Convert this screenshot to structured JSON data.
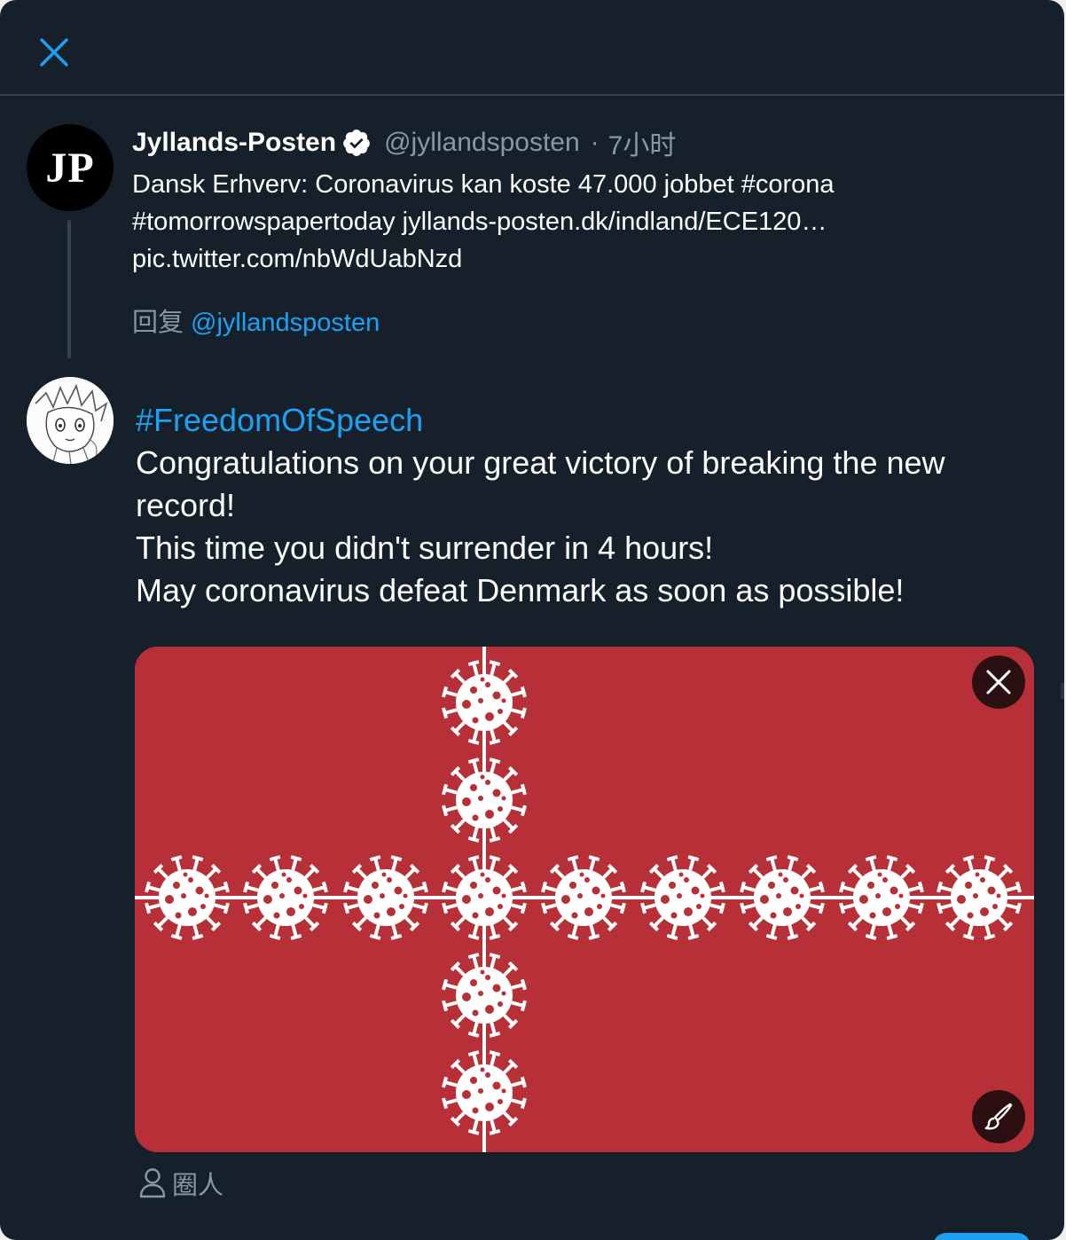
{
  "modal": {
    "close_icon": "close-icon"
  },
  "original_tweet": {
    "avatar_text": "JP",
    "display_name": "Jyllands-Posten",
    "verified_icon": "verified-badge-icon",
    "handle": "@jyllandsposten",
    "separator": "·",
    "time": "7小时",
    "text_lines": [
      "Dansk Erhverv: Coronavirus kan koste 47.000 jobbet #corona",
      "#tomorrowspapertoday jyllands-posten.dk/indland/ECE120…",
      "pic.twitter.com/nbWdUabNzd"
    ]
  },
  "reply": {
    "label": "回复",
    "handle": "@jyllandsposten"
  },
  "compose": {
    "hashtag": "#FreedomOfSpeech",
    "lines": [
      "Congratulations on your great victory of breaking the new",
      "record!",
      "This time you didn't surrender in 4 hours!",
      "May coronavirus defeat Denmark as soon as possible!"
    ]
  },
  "media": {
    "background_color": "#b72f37",
    "symbol_color": "#ffffff",
    "remove_icon": "close-icon",
    "edit_icon": "paintbrush-icon"
  },
  "tag_people": {
    "icon": "person-icon",
    "label": "圈人"
  },
  "colors": {
    "background": "#15202b",
    "border": "#38444d",
    "text_primary": "#ffffff",
    "text_secondary": "#8899a6",
    "accent": "#1da1f2"
  }
}
